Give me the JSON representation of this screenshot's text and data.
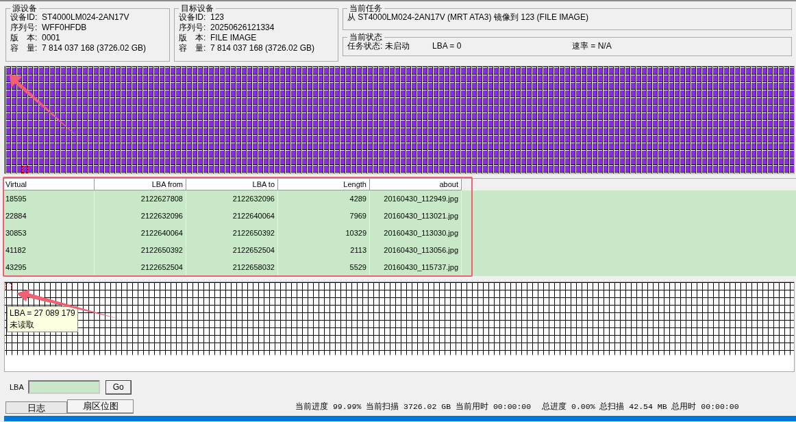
{
  "source_device": {
    "title": "源设备",
    "rows": [
      {
        "label": "设备ID:",
        "value": "ST4000LM024-2AN17V"
      },
      {
        "label": "序列号:",
        "value": "WFF0HFDB"
      },
      {
        "label": "版　本:",
        "value": "0001"
      },
      {
        "label": "容　量:",
        "value": "7 814 037 168 (3726.02 GB)"
      }
    ]
  },
  "target_device": {
    "title": "目标设备",
    "rows": [
      {
        "label": "设备ID:",
        "value": "123"
      },
      {
        "label": "序列号:",
        "value": "20250626121334"
      },
      {
        "label": "版　本:",
        "value": "FILE IMAGE"
      },
      {
        "label": "容　量:",
        "value": "7 814 037 168 (3726.02 GB)"
      }
    ]
  },
  "current_task": {
    "title": "当前任务",
    "text": "从 ST4000LM024-2AN17V (MRT ATA3) 镜像到 123 (FILE IMAGE)"
  },
  "current_status": {
    "title": "当前状态",
    "items": [
      "任务状态: 未启动",
      "LBA = 0",
      "速率 = N/A"
    ]
  },
  "table": {
    "columns": [
      "Virtual",
      "LBA from",
      "LBA to",
      "Length",
      "about"
    ],
    "rows": [
      [
        "18595",
        "2122627808",
        "2122632096",
        "4289",
        "20160430_112949.jpg"
      ],
      [
        "22884",
        "2122632096",
        "2122640064",
        "7969",
        "20160430_113021.jpg"
      ],
      [
        "30853",
        "2122640064",
        "2122650392",
        "10329",
        "20160430_113030.jpg"
      ],
      [
        "41182",
        "2122650392",
        "2122652504",
        "2113",
        "20160430_113056.jpg"
      ],
      [
        "43295",
        "2122652504",
        "2122658032",
        "5529",
        "20160430_115737.jpg"
      ]
    ]
  },
  "tooltip": [
    "LBA = 27 089 179",
    "未读取"
  ],
  "lba_field": {
    "label": "LBA"
  },
  "go_button": "Go",
  "tabs": [
    {
      "label": "日志",
      "selected": false
    },
    {
      "label": "扇区位图",
      "selected": true
    }
  ],
  "status_bar": [
    "当前进度 99.99% 当前扫描 3726.02 GB 当前用时 00:00:00",
    "总进度 0.00% 总扫描 42.54 MB 总用时 00:00:00"
  ],
  "progress": {
    "level": 1
  }
}
